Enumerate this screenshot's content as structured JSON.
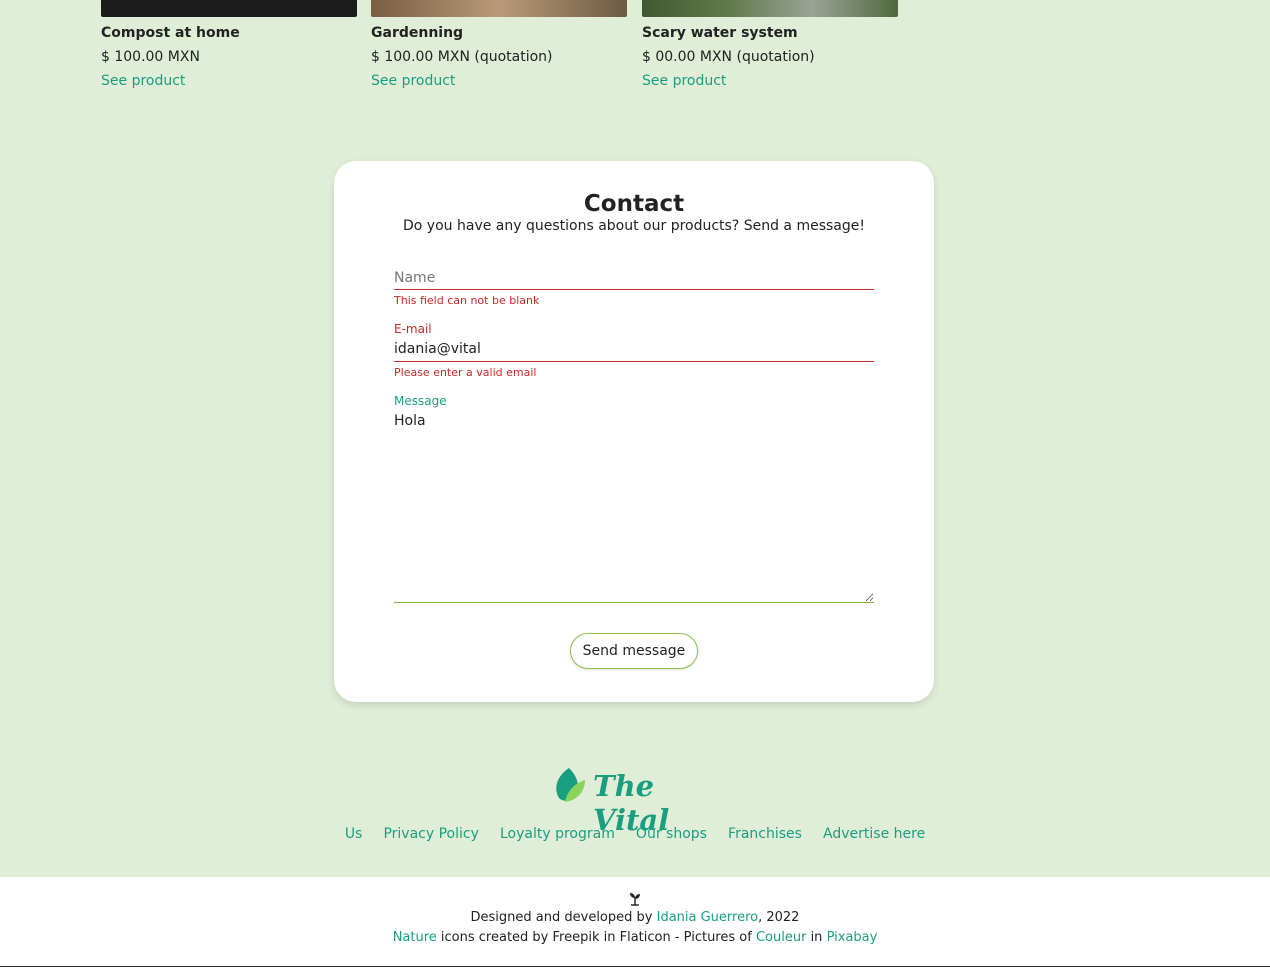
{
  "products": [
    {
      "title": "Compost at home",
      "price": "$ 100.00 MXN",
      "link": "See product",
      "image_color": "#1c1c1c"
    },
    {
      "title": "Gardenning",
      "price": "$ 100.00 MXN (quotation)",
      "link": "See product",
      "image_color": "#8a6b4f"
    },
    {
      "title": "Scary water system",
      "price": "$ 00.00 MXN (quotation)",
      "link": "See product",
      "image_color": "#4f6a3d"
    }
  ],
  "contact": {
    "title": "Contact",
    "subtitle": "Do you have any questions about our products? Send a message!",
    "name": {
      "label": "Name",
      "value": "",
      "error": "This field can not be blank"
    },
    "email": {
      "label": "E-mail",
      "value": "idania@vital",
      "error": "Please enter a valid email"
    },
    "message": {
      "label": "Message",
      "value": "Hola"
    },
    "send_label": "Send message"
  },
  "brand": {
    "name": "The Vital"
  },
  "footer_nav": [
    "Us",
    "Privacy Policy",
    "Loyalty program",
    "Our shops",
    "Franchises",
    "Advertise here"
  ],
  "credits": {
    "designed_prefix": "Designed and developed by",
    "author": "Idania Guerrero",
    "year_suffix": ", 2022",
    "nature": "Nature",
    "icons_text": "icons created by Freepik in Flaticon - Pictures of",
    "couleur": "Couleur",
    "in_word": "in",
    "pixabay": "Pixabay"
  },
  "colors": {
    "accent": "#1a9e80",
    "error": "#c62828",
    "background": "#e0eed8"
  }
}
